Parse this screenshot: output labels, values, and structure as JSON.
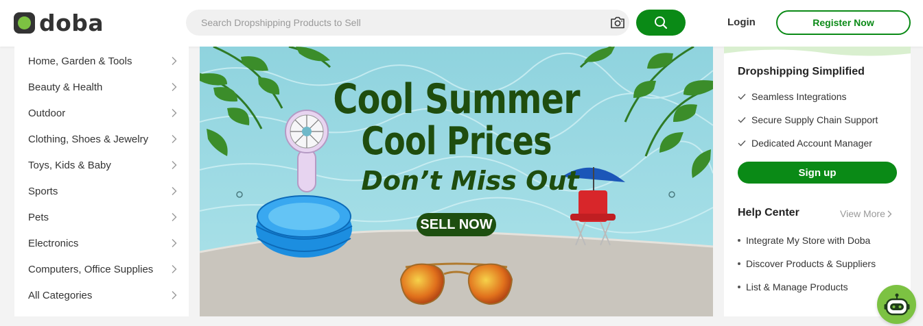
{
  "header": {
    "logo_text": "doba",
    "search_placeholder": "Search Dropshipping Products to Sell",
    "login_label": "Login",
    "register_label": "Register Now"
  },
  "sidebar": {
    "categories": [
      {
        "label": "Home, Garden & Tools"
      },
      {
        "label": "Beauty & Health"
      },
      {
        "label": "Outdoor"
      },
      {
        "label": "Clothing, Shoes & Jewelry"
      },
      {
        "label": "Toys, Kids & Baby"
      },
      {
        "label": "Sports"
      },
      {
        "label": "Pets"
      },
      {
        "label": "Electronics"
      },
      {
        "label": "Computers, Office Supplies"
      },
      {
        "label": "All Categories"
      }
    ]
  },
  "banner": {
    "title_line1": "Cool Summer",
    "title_line2": "Cool Prices",
    "subtitle": "Don’t Miss Out",
    "cta_label": "SELL NOW"
  },
  "right_panel": {
    "title": "Dropshipping Simplified",
    "features": [
      "Seamless Integrations",
      "Secure Supply Chain Support",
      "Dedicated Account Manager"
    ],
    "signup_label": "Sign up",
    "help_title": "Help Center",
    "view_more_label": "View More",
    "help_items": [
      "Integrate My Store with Doba",
      "Discover Products & Suppliers",
      "List & Manage Products"
    ]
  },
  "colors": {
    "brand_green": "#0a8a16",
    "logo_green": "#7cc242",
    "banner_text": "#1f4d0e"
  },
  "icons": [
    "camera-icon",
    "search-icon",
    "chevron-right-icon",
    "check-icon",
    "chatbot-icon"
  ]
}
